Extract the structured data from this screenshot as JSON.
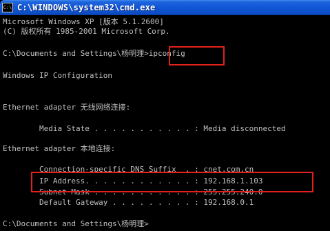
{
  "window": {
    "title": "C:\\WINDOWS\\system32\\cmd.exe",
    "icon": "console-icon",
    "icon_glyph": "C:\\",
    "accent_color": "#0d4ec9",
    "highlight_color": "#e4201c"
  },
  "console": {
    "lines": [
      "Microsoft Windows XP [版本 5.1.2600]",
      "(C) 版权所有 1985-2001 Microsoft Corp.",
      "",
      "C:\\Documents and Settings\\杨明理>ipconfig",
      "",
      "Windows IP Configuration",
      "",
      "",
      "Ethernet adapter 无线网络连接:",
      "",
      "        Media State . . . . . . . . . . . : Media disconnected",
      "",
      "Ethernet adapter 本地连接:",
      "",
      "        Connection-specific DNS Suffix  . : cnet.com.cn",
      "        IP Address. . . . . . . . . . . . : 192.168.1.103",
      "        Subnet Mask . . . . . . . . . . . : 255.255.240.0",
      "        Default Gateway . . . . . . . . . : 192.168.0.1",
      "",
      "C:\\Documents and Settings\\杨明理>"
    ]
  }
}
